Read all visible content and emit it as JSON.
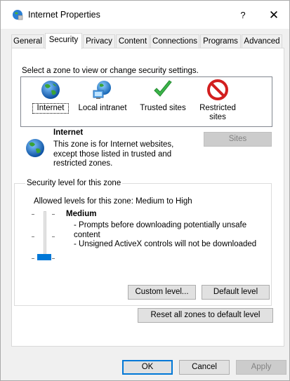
{
  "window": {
    "title": "Internet Properties",
    "help_label": "?",
    "close_label": "✕"
  },
  "tabs": [
    {
      "label": "General"
    },
    {
      "label": "Security",
      "active": true
    },
    {
      "label": "Privacy"
    },
    {
      "label": "Content"
    },
    {
      "label": "Connections"
    },
    {
      "label": "Programs"
    },
    {
      "label": "Advanced"
    }
  ],
  "security": {
    "prompt": "Select a zone to view or change security settings.",
    "zones": [
      {
        "label": "Internet",
        "icon": "globe-icon",
        "selected": true
      },
      {
        "label": "Local intranet",
        "icon": "intranet-icon"
      },
      {
        "label": "Trusted sites",
        "icon": "checkmark-icon"
      },
      {
        "label": "Restricted sites",
        "icon": "restricted-icon"
      }
    ],
    "zone_description": {
      "title": "Internet",
      "text": "This zone is for Internet websites, except those listed in trusted and restricted zones."
    },
    "sites_button": "Sites",
    "level_group": {
      "legend": "Security level for this zone",
      "allowed": "Allowed levels for this zone: Medium to High",
      "level_name": "Medium",
      "desc_lines": [
        "- Prompts before downloading potentially unsafe content",
        "- Unsigned ActiveX controls will not be downloaded"
      ],
      "slider_level": "Medium",
      "custom_level_button": "Custom level...",
      "default_level_button": "Default level"
    },
    "reset_all_button": "Reset all zones to default level"
  },
  "footer": {
    "ok": "OK",
    "cancel": "Cancel",
    "apply": "Apply"
  },
  "colors": {
    "accent": "#0078d7",
    "disabled_bg": "#cccccc",
    "disabled_text": "#838383"
  }
}
